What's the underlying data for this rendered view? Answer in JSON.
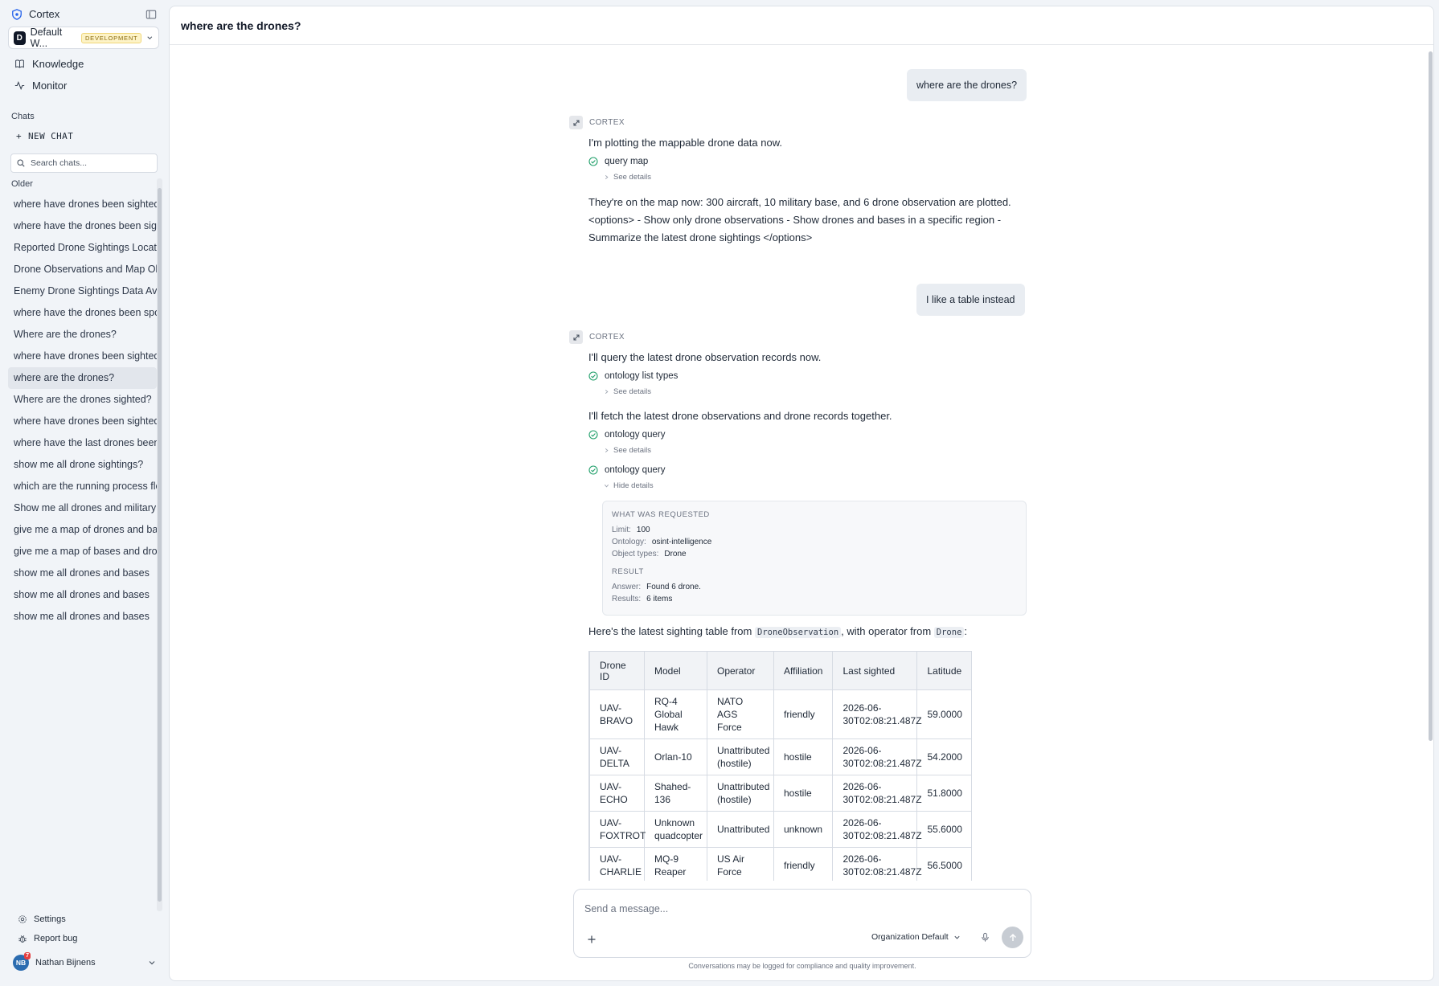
{
  "sidebar": {
    "app_name": "Cortex",
    "workspace": {
      "initial": "D",
      "name": "Default W...",
      "badge": "DEVELOPMENT"
    },
    "nav": [
      {
        "label": "Knowledge",
        "icon": "book-icon"
      },
      {
        "label": "Monitor",
        "icon": "activity-icon"
      }
    ],
    "chats_label": "Chats",
    "new_chat_label": "NEW CHAT",
    "search_placeholder": "Search chats...",
    "older_label": "Older",
    "chats": [
      "where have drones been sighted?",
      "where have the drones been sighted?",
      "Reported Drone Sightings Locations",
      "Drone Observations and Map Objects",
      "Enemy Drone Sightings Data Available",
      "where have the drones been spotted?",
      "Where are the drones?",
      "where have drones been sighted?",
      "where are the drones?",
      "Where are the drones sighted?",
      "where have drones been sighted?",
      "where have the last drones been seen?",
      "show me all drone sightings?",
      "which are the running process flows?",
      "Show me all drones and military bases",
      "give me a map of drones and bases",
      "give me a map of bases and drones",
      "show me all drones and bases",
      "show me all drones and bases",
      "show me all drones and bases"
    ],
    "active_chat_index": 8,
    "settings_label": "Settings",
    "report_bug_label": "Report bug",
    "user": {
      "initials": "NB",
      "badge": "7",
      "name": "Nathan Bijnens"
    }
  },
  "main": {
    "title": "where are the drones?",
    "messages": {
      "user_1": "where are the drones?",
      "assistant_name": "CORTEX",
      "a1_text_1": "I'm plotting the mappable drone data now.",
      "a1_tool": "query map",
      "see_details": "See details",
      "hide_details": "Hide details",
      "a1_text_2": "They're on the map now: 300 aircraft, 10 military base, and 6 drone observation are plotted. <options> - Show only drone observations - Show drones and bases in a specific region - Summarize the latest drone sightings </options>",
      "user_2": "I like a table instead",
      "a2_text_1": "I'll query the latest drone observation records now.",
      "a2_tool_1": "ontology list types",
      "a2_text_2": "I'll fetch the latest drone observations and drone records together.",
      "a2_tool_2": "ontology query",
      "a2_tool_3": "ontology query",
      "a2_text_3_before": "Here's the latest sighting table from",
      "a2_code_1": "DroneObservation",
      "a2_text_3_middle": ", with operator from",
      "a2_code_2": "Drone",
      "a2_text_3_after": ":"
    },
    "details": {
      "requested_label": "WHAT WAS REQUESTED",
      "limit_key": "Limit:",
      "limit_val": "100",
      "ontology_key": "Ontology:",
      "ontology_val": "osint-intelligence",
      "types_key": "Object types:",
      "types_val": "Drone",
      "result_label": "RESULT",
      "answer_key": "Answer:",
      "answer_val": "Found 6 drone.",
      "results_key": "Results:",
      "results_val": "6 items"
    },
    "table": {
      "headers": [
        "Drone ID",
        "Model",
        "Operator",
        "Affiliation",
        "Last sighted",
        "Latitude"
      ],
      "rows": [
        [
          "UAV-BRAVO",
          "RQ-4 Global Hawk",
          "NATO AGS Force",
          "friendly",
          "2026-06-30T02:08:21.487Z",
          "59.0000"
        ],
        [
          "UAV-DELTA",
          "Orlan-10",
          "Unattributed (hostile)",
          "hostile",
          "2026-06-30T02:08:21.487Z",
          "54.2000"
        ],
        [
          "UAV-ECHO",
          "Shahed-136",
          "Unattributed (hostile)",
          "hostile",
          "2026-06-30T02:08:21.487Z",
          "51.8000"
        ],
        [
          "UAV-FOXTROT",
          "Unknown quadcopter",
          "Unattributed",
          "unknown",
          "2026-06-30T02:08:21.487Z",
          "55.6000"
        ],
        [
          "UAV-CHARLIE",
          "MQ-9 Reaper",
          "US Air Force",
          "friendly",
          "2026-06-30T02:08:21.487Z",
          "56.5000"
        ]
      ]
    },
    "composer": {
      "placeholder": "Send a message...",
      "model_label": "Organization Default",
      "disclaimer": "Conversations may be logged for compliance and quality improvement."
    }
  }
}
